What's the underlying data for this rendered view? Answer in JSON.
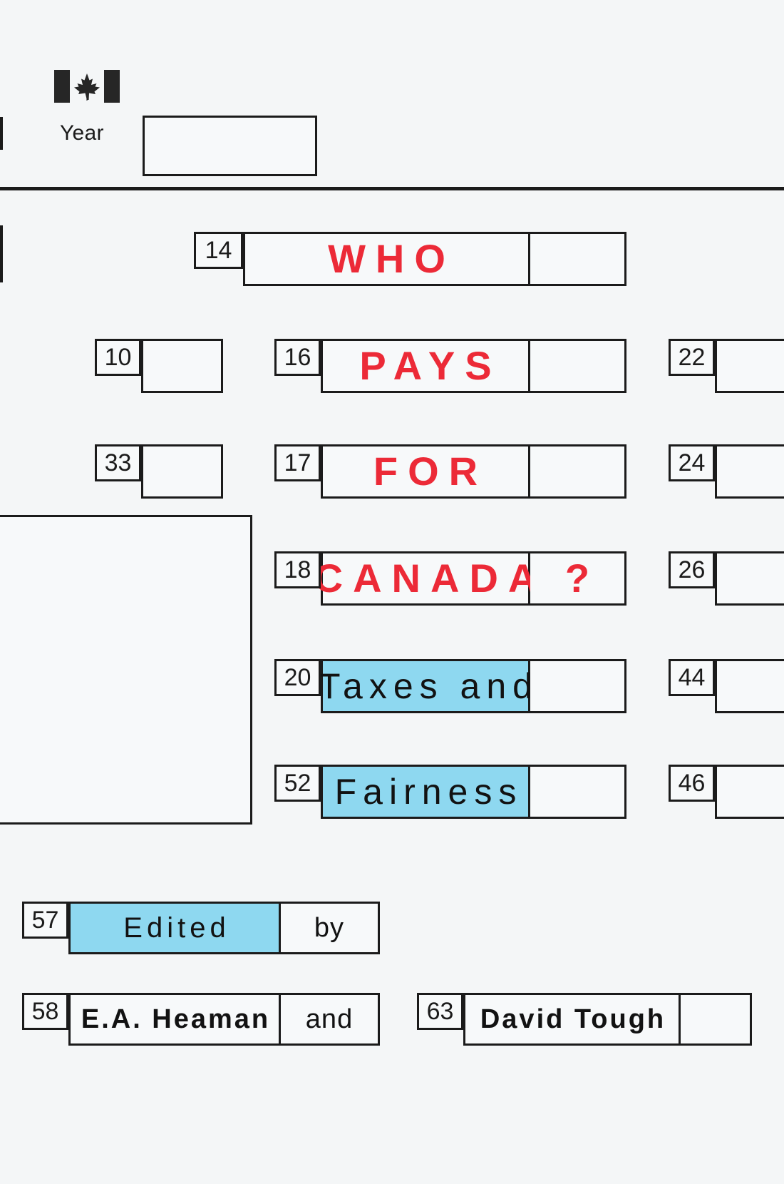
{
  "document": {
    "kind": "book-cover",
    "background_color": "#f4f6f7",
    "accent_red": "#ec2a37",
    "highlight_blue": "#8ed8f0",
    "ink": "#1b1b1b"
  },
  "header": {
    "flag_icon": "canada-flag-icon",
    "year_label": "Year",
    "year_value": ""
  },
  "title_rows": [
    {
      "number": "14",
      "text": "WHO",
      "style": "red",
      "trailing": ""
    },
    {
      "number": "16",
      "text": "PAYS",
      "style": "red",
      "trailing": ""
    },
    {
      "number": "17",
      "text": "FOR",
      "style": "red",
      "trailing": ""
    },
    {
      "number": "18",
      "text": "CANADA",
      "style": "red",
      "trailing": "?"
    },
    {
      "number": "20",
      "text": "Taxes and",
      "style": "blue",
      "trailing": ""
    },
    {
      "number": "52",
      "text": "Fairness",
      "style": "blue",
      "trailing": ""
    }
  ],
  "left_fields": [
    {
      "number": "10",
      "value": ""
    },
    {
      "number": "33",
      "value": ""
    }
  ],
  "right_fields": [
    {
      "number": "22",
      "value": ""
    },
    {
      "number": "24",
      "value": ""
    },
    {
      "number": "26",
      "value": ""
    },
    {
      "number": "44",
      "value": ""
    },
    {
      "number": "46",
      "value": ""
    }
  ],
  "byline": {
    "edited_number": "57",
    "edited_word": "Edited",
    "by_word": "by",
    "author_one_number": "58",
    "author_one": "E.A. Heaman",
    "and_word": "and",
    "author_two_number": "63",
    "author_two": "David Tough"
  }
}
